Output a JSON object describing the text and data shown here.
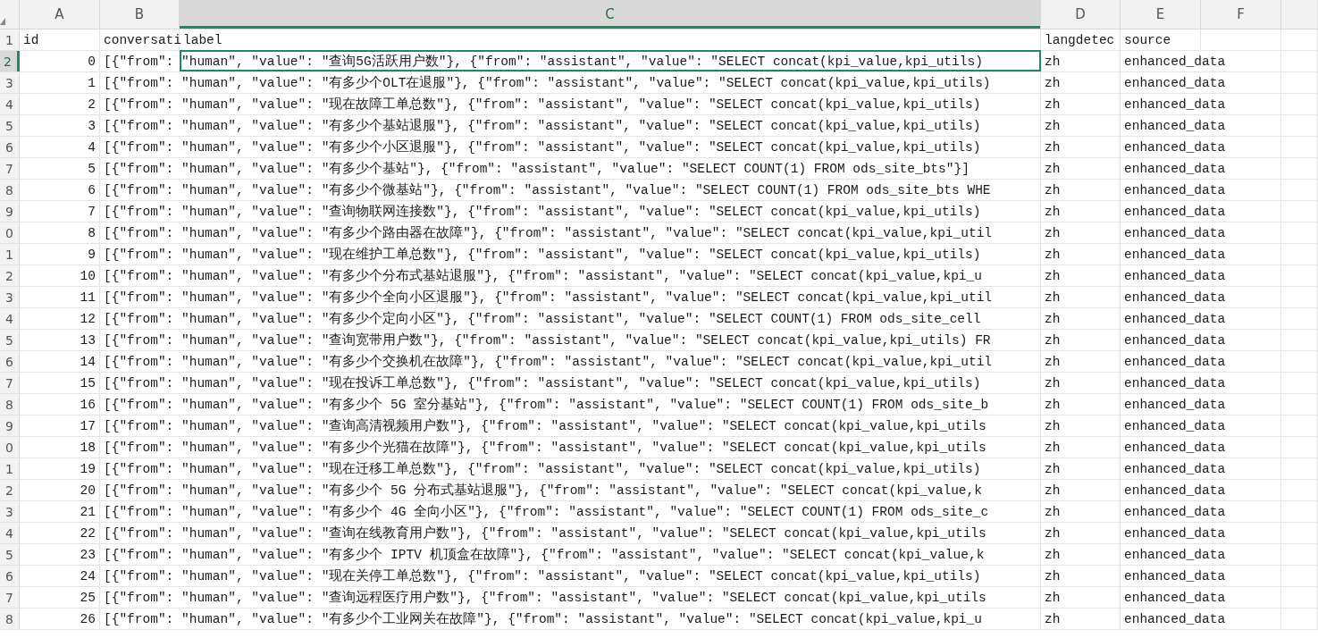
{
  "columns": [
    {
      "letter": "A",
      "selected": false
    },
    {
      "letter": "B",
      "selected": false
    },
    {
      "letter": "C",
      "selected": true
    },
    {
      "letter": "D",
      "selected": false
    },
    {
      "letter": "E",
      "selected": false
    },
    {
      "letter": "F",
      "selected": false
    }
  ],
  "header_row": {
    "number": "1",
    "selected": false,
    "cells": [
      "id",
      "conversati",
      "label",
      "langdetec",
      "source"
    ]
  },
  "rows": [
    {
      "number": "2",
      "selected": true,
      "id": "0",
      "conversations": "[{\"from\": \"human\", \"value\": \"查询5G活跃用户数\"}, {\"from\": \"assistant\", \"value\": \"SELECT concat(kpi_value,kpi_utils)",
      "langdetect": "zh",
      "source": "enhanced_data"
    },
    {
      "number": "3",
      "selected": false,
      "id": "1",
      "conversations": "[{\"from\": \"human\", \"value\": \"有多少个OLT在退服\"}, {\"from\": \"assistant\", \"value\": \"SELECT concat(kpi_value,kpi_utils)",
      "langdetect": "zh",
      "source": "enhanced_data"
    },
    {
      "number": "4",
      "selected": false,
      "id": "2",
      "conversations": "[{\"from\": \"human\", \"value\": \"现在故障工单总数\"}, {\"from\": \"assistant\", \"value\": \"SELECT concat(kpi_value,kpi_utils)",
      "langdetect": "zh",
      "source": "enhanced_data"
    },
    {
      "number": "5",
      "selected": false,
      "id": "3",
      "conversations": "[{\"from\": \"human\", \"value\": \"有多少个基站退服\"}, {\"from\": \"assistant\", \"value\": \"SELECT concat(kpi_value,kpi_utils)",
      "langdetect": "zh",
      "source": "enhanced_data"
    },
    {
      "number": "6",
      "selected": false,
      "id": "4",
      "conversations": "[{\"from\": \"human\", \"value\": \"有多少个小区退服\"}, {\"from\": \"assistant\", \"value\": \"SELECT concat(kpi_value,kpi_utils)",
      "langdetect": "zh",
      "source": "enhanced_data"
    },
    {
      "number": "7",
      "selected": false,
      "id": "5",
      "conversations": "[{\"from\": \"human\", \"value\": \"有多少个基站\"}, {\"from\": \"assistant\", \"value\": \"SELECT COUNT(1) FROM ods_site_bts\"}]",
      "langdetect": "zh",
      "source": "enhanced_data"
    },
    {
      "number": "8",
      "selected": false,
      "id": "6",
      "conversations": "[{\"from\": \"human\", \"value\": \"有多少个微基站\"}, {\"from\": \"assistant\", \"value\": \"SELECT COUNT(1) FROM ods_site_bts WHE",
      "langdetect": "zh",
      "source": "enhanced_data"
    },
    {
      "number": "9",
      "selected": false,
      "id": "7",
      "conversations": "[{\"from\": \"human\", \"value\": \"查询物联网连接数\"}, {\"from\": \"assistant\", \"value\": \"SELECT concat(kpi_value,kpi_utils)",
      "langdetect": "zh",
      "source": "enhanced_data"
    },
    {
      "number": "0",
      "selected": false,
      "id": "8",
      "conversations": "[{\"from\": \"human\", \"value\": \"有多少个路由器在故障\"}, {\"from\": \"assistant\", \"value\": \"SELECT concat(kpi_value,kpi_util",
      "langdetect": "zh",
      "source": "enhanced_data"
    },
    {
      "number": "1",
      "selected": false,
      "id": "9",
      "conversations": "[{\"from\": \"human\", \"value\": \"现在维护工单总数\"}, {\"from\": \"assistant\", \"value\": \"SELECT concat(kpi_value,kpi_utils)",
      "langdetect": "zh",
      "source": "enhanced_data"
    },
    {
      "number": "2",
      "selected": false,
      "id": "10",
      "conversations": "[{\"from\": \"human\", \"value\": \"有多少个分布式基站退服\"}, {\"from\": \"assistant\", \"value\": \"SELECT concat(kpi_value,kpi_u",
      "langdetect": "zh",
      "source": "enhanced_data"
    },
    {
      "number": "3",
      "selected": false,
      "id": "11",
      "conversations": "[{\"from\": \"human\", \"value\": \"有多少个全向小区退服\"}, {\"from\": \"assistant\", \"value\": \"SELECT concat(kpi_value,kpi_util",
      "langdetect": "zh",
      "source": "enhanced_data"
    },
    {
      "number": "4",
      "selected": false,
      "id": "12",
      "conversations": "[{\"from\": \"human\", \"value\": \"有多少个定向小区\"}, {\"from\": \"assistant\", \"value\": \"SELECT COUNT(1) FROM ods_site_cell",
      "langdetect": "zh",
      "source": "enhanced_data"
    },
    {
      "number": "5",
      "selected": false,
      "id": "13",
      "conversations": "[{\"from\": \"human\", \"value\": \"查询宽带用户数\"}, {\"from\": \"assistant\", \"value\": \"SELECT concat(kpi_value,kpi_utils) FR",
      "langdetect": "zh",
      "source": "enhanced_data"
    },
    {
      "number": "6",
      "selected": false,
      "id": "14",
      "conversations": "[{\"from\": \"human\", \"value\": \"有多少个交换机在故障\"}, {\"from\": \"assistant\", \"value\": \"SELECT concat(kpi_value,kpi_util",
      "langdetect": "zh",
      "source": "enhanced_data"
    },
    {
      "number": "7",
      "selected": false,
      "id": "15",
      "conversations": "[{\"from\": \"human\", \"value\": \"现在投诉工单总数\"}, {\"from\": \"assistant\", \"value\": \"SELECT concat(kpi_value,kpi_utils)",
      "langdetect": "zh",
      "source": "enhanced_data"
    },
    {
      "number": "8",
      "selected": false,
      "id": "16",
      "conversations": "[{\"from\": \"human\", \"value\": \"有多少个 5G 室分基站\"}, {\"from\": \"assistant\", \"value\": \"SELECT COUNT(1) FROM ods_site_b",
      "langdetect": "zh",
      "source": "enhanced_data"
    },
    {
      "number": "9",
      "selected": false,
      "id": "17",
      "conversations": "[{\"from\": \"human\", \"value\": \"查询高清视频用户数\"}, {\"from\": \"assistant\", \"value\": \"SELECT concat(kpi_value,kpi_utils",
      "langdetect": "zh",
      "source": "enhanced_data"
    },
    {
      "number": "0",
      "selected": false,
      "id": "18",
      "conversations": "[{\"from\": \"human\", \"value\": \"有多少个光猫在故障\"}, {\"from\": \"assistant\", \"value\": \"SELECT concat(kpi_value,kpi_utils",
      "langdetect": "zh",
      "source": "enhanced_data"
    },
    {
      "number": "1",
      "selected": false,
      "id": "19",
      "conversations": "[{\"from\": \"human\", \"value\": \"现在迁移工单总数\"}, {\"from\": \"assistant\", \"value\": \"SELECT concat(kpi_value,kpi_utils)",
      "langdetect": "zh",
      "source": "enhanced_data"
    },
    {
      "number": "2",
      "selected": false,
      "id": "20",
      "conversations": "[{\"from\": \"human\", \"value\": \"有多少个 5G 分布式基站退服\"}, {\"from\": \"assistant\", \"value\": \"SELECT concat(kpi_value,k",
      "langdetect": "zh",
      "source": "enhanced_data"
    },
    {
      "number": "3",
      "selected": false,
      "id": "21",
      "conversations": "[{\"from\": \"human\", \"value\": \"有多少个 4G 全向小区\"}, {\"from\": \"assistant\", \"value\": \"SELECT COUNT(1) FROM ods_site_c",
      "langdetect": "zh",
      "source": "enhanced_data"
    },
    {
      "number": "4",
      "selected": false,
      "id": "22",
      "conversations": "[{\"from\": \"human\", \"value\": \"查询在线教育用户数\"}, {\"from\": \"assistant\", \"value\": \"SELECT concat(kpi_value,kpi_utils",
      "langdetect": "zh",
      "source": "enhanced_data"
    },
    {
      "number": "5",
      "selected": false,
      "id": "23",
      "conversations": "[{\"from\": \"human\", \"value\": \"有多少个 IPTV 机顶盒在故障\"}, {\"from\": \"assistant\", \"value\": \"SELECT concat(kpi_value,k",
      "langdetect": "zh",
      "source": "enhanced_data"
    },
    {
      "number": "6",
      "selected": false,
      "id": "24",
      "conversations": "[{\"from\": \"human\", \"value\": \"现在关停工单总数\"}, {\"from\": \"assistant\", \"value\": \"SELECT concat(kpi_value,kpi_utils)",
      "langdetect": "zh",
      "source": "enhanced_data"
    },
    {
      "number": "7",
      "selected": false,
      "id": "25",
      "conversations": "[{\"from\": \"human\", \"value\": \"查询远程医疗用户数\"}, {\"from\": \"assistant\", \"value\": \"SELECT concat(kpi_value,kpi_utils",
      "langdetect": "zh",
      "source": "enhanced_data"
    },
    {
      "number": "8",
      "selected": false,
      "id": "26",
      "conversations": "[{\"from\": \"human\", \"value\": \"有多少个工业网关在故障\"}, {\"from\": \"assistant\", \"value\": \"SELECT concat(kpi_value,kpi_u",
      "langdetect": "zh",
      "source": "enhanced_data"
    }
  ]
}
